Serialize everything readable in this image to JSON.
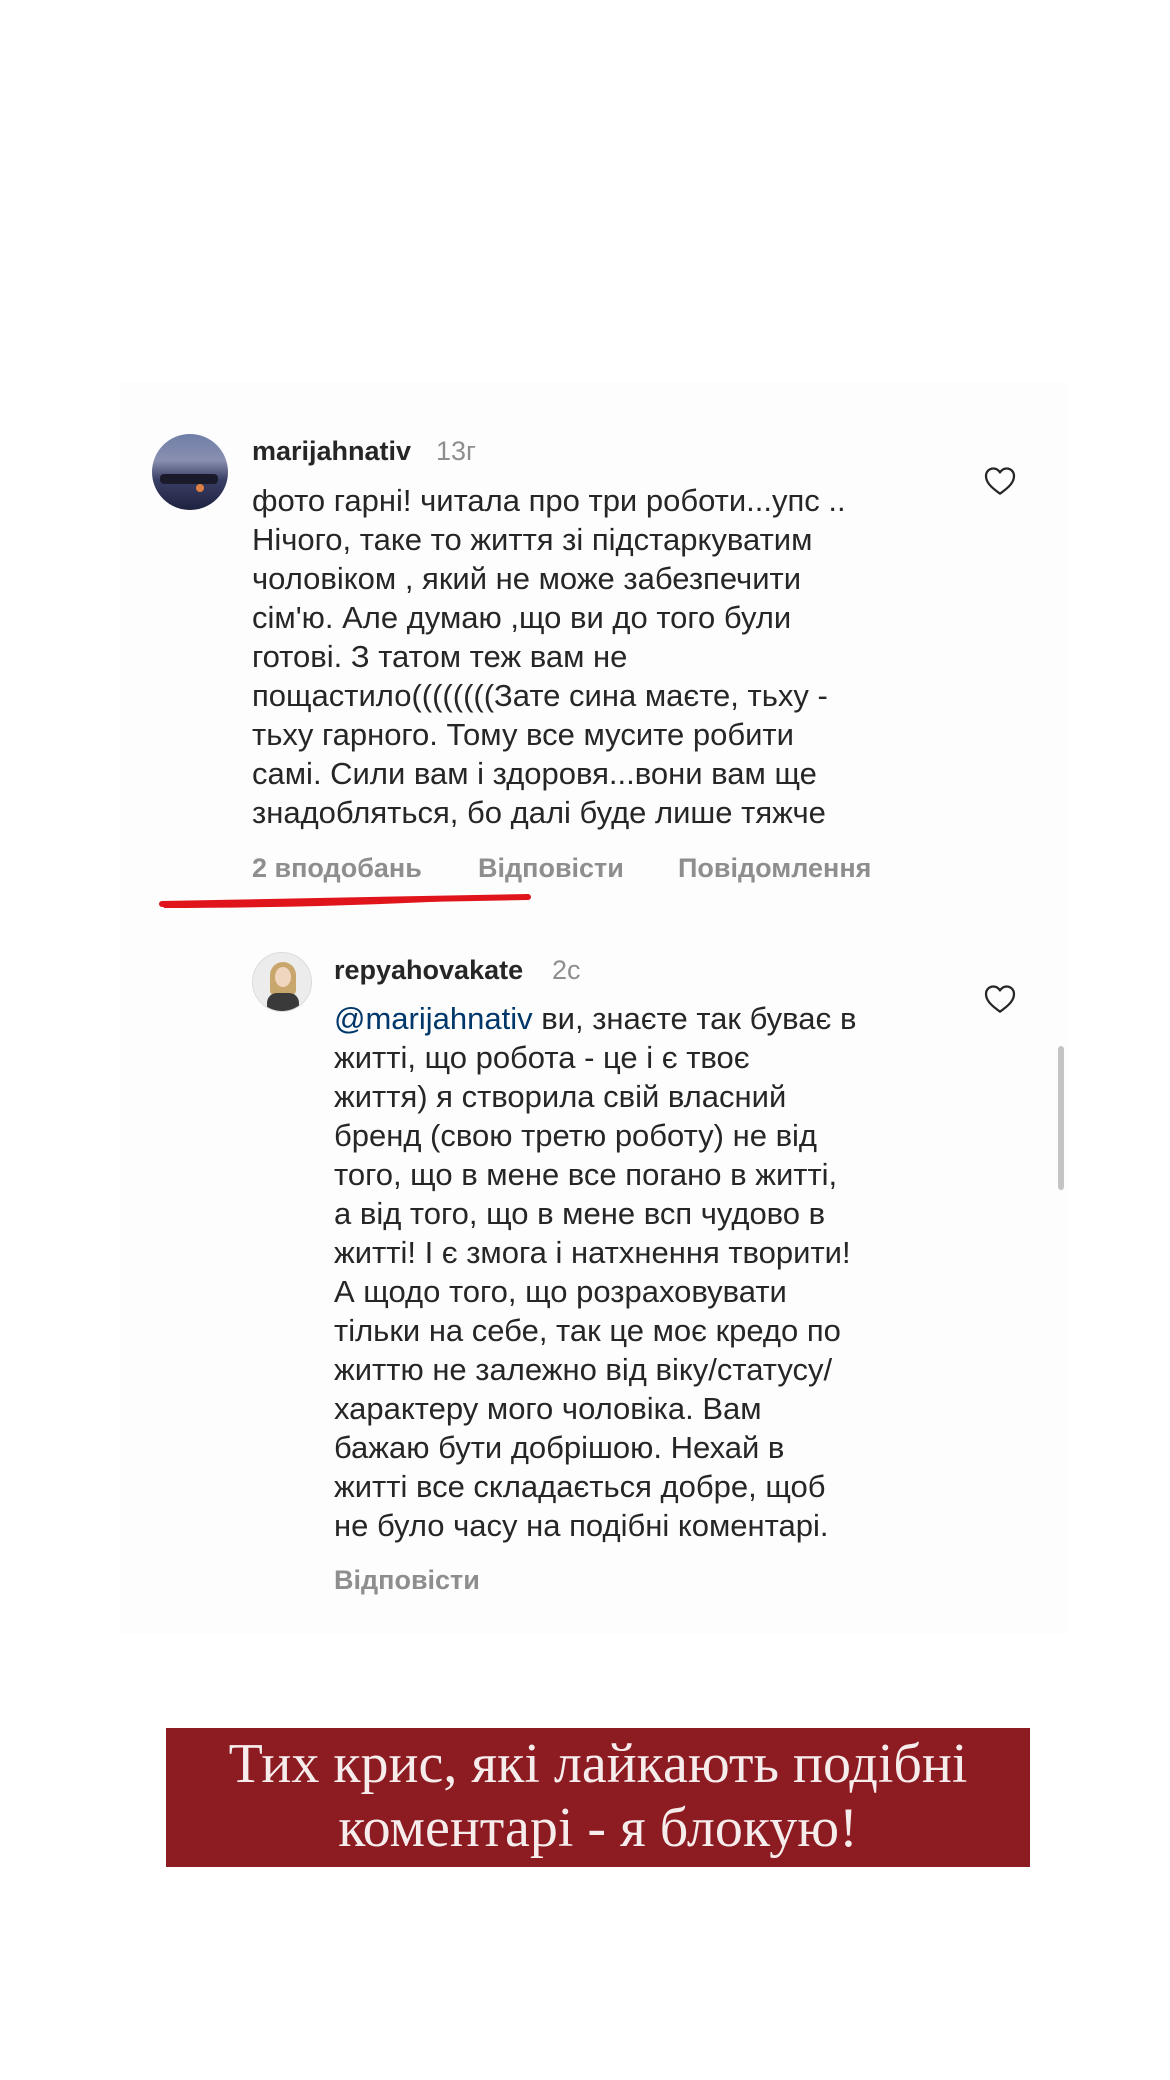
{
  "comment": {
    "username": "marijahnativ",
    "time": "13г",
    "text": "фото гарні! читала про три роботи...упс ..\nНічого, таке то життя зі підстаркуватим\nчоловіком , який не може забезпечити\nсім'ю.  Але думаю ,що ви до того були\nготові.  З татом теж вам не\nпощастило((((((((Зате сина маєте, тьху -\nтьху гарного.  Тому все мусите робити\nсамі.  Сили вам і здоровя...вони вам ще\nзнадобляться, бо далі буде лише тяжче",
    "likes": "2 вподобань",
    "reply_label": "Відповісти",
    "report_label": "Повідомлення",
    "avatar_icon": "avatar-photo",
    "like_icon": "heart-outline-icon"
  },
  "reply": {
    "username": "repyahovakate",
    "time": "2с",
    "mention": "@marijahnativ",
    "text_first": " ви, знаєте так буває в",
    "text": "житті, що робота - це і є твоє\nжиття) я створила свій власний\nбренд (свою третю роботу) не від\nтого, що в мене все погано в житті,\nа від того, що в мене всп чудово в\nжитті! І є змога і натхнення творити!\nА щодо того, що розраховувати\nтільки на себе, так це моє кредо по\nжиттю не залежно від віку/статусу/\nхарактеру мого чоловіка. Вам\nбажаю бути добрішою. Нехай в\nжитті все складається добре, щоб\nне було часу на подібні коментарі.",
    "reply_label": "Відповісти",
    "avatar_icon": "avatar-photo",
    "like_icon": "heart-outline-icon"
  },
  "banner": {
    "line1": "Тих крис, які лайкають подібні",
    "line2": "коментарі - я блокую!"
  },
  "colors": {
    "banner_bg": "#8c1c22",
    "underline": "#e0151b",
    "mention": "#00376b",
    "muted": "#8e8e8e"
  }
}
